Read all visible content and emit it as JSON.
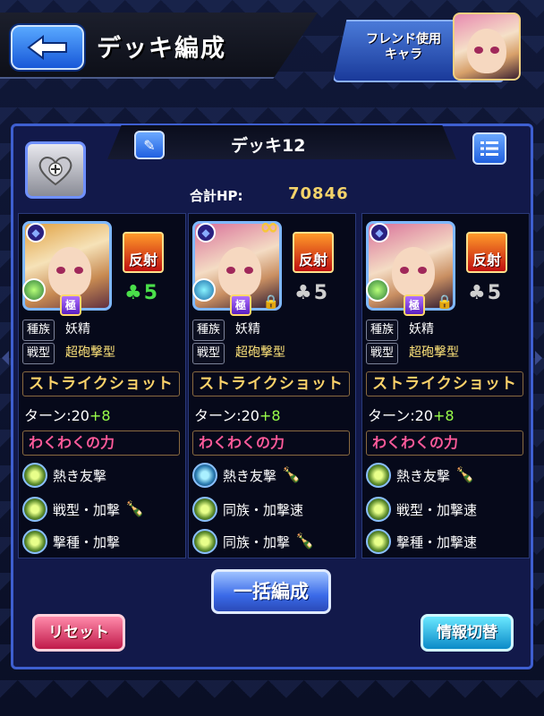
{
  "header": {
    "title": "デッキ編成",
    "friend_label_1": "フレンド使用",
    "friend_label_2": "キャラ"
  },
  "deck": {
    "name": "デッキ12",
    "hp_label": "合計HP:",
    "hp_value": "70846"
  },
  "cards": [
    {
      "ability": "反射",
      "luck": "5",
      "clover_color": "#4adf4a",
      "race_label": "種族",
      "race": "妖精",
      "type_label": "戦型",
      "type": "超砲撃型",
      "strike_shot": "ストライクショット",
      "turn_label": "ターン:20",
      "turn_plus": "+8",
      "wakuwaku": "わくわくの力",
      "abilities": [
        "熱き友撃",
        "戦型・加撃",
        "撃種・加撃"
      ]
    },
    {
      "ability": "反射",
      "luck": "5",
      "clover_color": "#cfcfcf",
      "race_label": "種族",
      "race": "妖精",
      "type_label": "戦型",
      "type": "超砲撃型",
      "strike_shot": "ストライクショット",
      "turn_label": "ターン:20",
      "turn_plus": "+8",
      "wakuwaku": "わくわくの力",
      "abilities": [
        "熱き友撃",
        "同族・加撃速",
        "同族・加撃"
      ]
    },
    {
      "ability": "反射",
      "luck": "5",
      "clover_color": "#cfcfcf",
      "race_label": "種族",
      "race": "妖精",
      "type_label": "戦型",
      "type": "超砲撃型",
      "strike_shot": "ストライクショット",
      "turn_label": "ターン:20",
      "turn_plus": "+8",
      "wakuwaku": "わくわくの力",
      "abilities": [
        "熱き友撃",
        "戦型・加撃速",
        "撃種・加撃速"
      ]
    }
  ],
  "buttons": {
    "bulk": "一括編成",
    "reset": "リセット",
    "info": "情報切替"
  },
  "icons": {
    "back": "back-arrow-icon",
    "edit": "pencil-icon",
    "list": "list-icon",
    "heart": "heart-plus-icon",
    "lock": "lock-icon",
    "link": "link-icon",
    "bottle": "bottle-icon"
  }
}
